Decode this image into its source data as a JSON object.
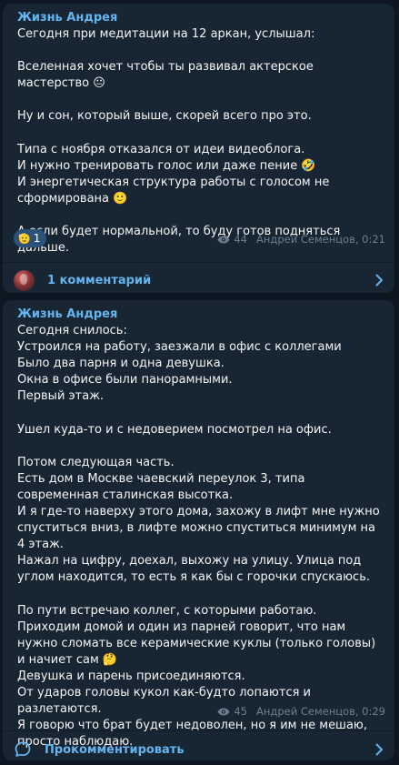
{
  "posts": [
    {
      "channel": "Жизнь Андрея",
      "text": "Сегодня при медитации на 12 аркан, услышал:\n\nВселенная хочет чтобы ты развивал актерское мастерство 😐\n\nНу и сон, который выше, скорей всего про это.\n\nТипа с ноября отказался от идеи видеоблога.\nИ нужно тренировать голос или даже пение 🤣\nИ энергетическая структура работы с голосом не сформирована 🙂\n\nА если будет нормальной, то буду готов подняться дальше.",
      "reaction_emoji": "🫡",
      "reaction_count": "1",
      "views": "44",
      "author_time": "Андрей Семенцов, 0:21",
      "comments_label": "1 комментарий",
      "icon": "eye-icon"
    },
    {
      "channel": "Жизнь Андрея",
      "text": "Сегодня снилось:\nУстроился на работу, заезжали в офис с коллегами\nБыло два парня и одна девушка.\nОкна в офисе были панорамными.\nПервый этаж.\n\nУшел куда-то и с недоверием посмотрел на офис.\n\nПотом следующая часть.\nЕсть дом в Москве чаевский переулок 3, типа современная сталинская высотка.\nИ я где-то наверху этого дома, захожу в лифт мне нужно спуститься вниз, в лифте можно спуститься минимум на 4 этаж.\nНажал на цифру, доехал, выхожу на улицу. Улица под углом находится, то есть я как бы с горочки спускаюсь.\n\nПо пути встречаю коллег, с которыми работаю.\nПриходим домой и один из парней говорит, что нам нужно сломать все керамические куклы (только головы) и начиет сам 🤔\nДевушка и парень присоединяются.\nОт ударов головы кукол как-будто лопаются и разлетаются.\nЯ говорю что брат будет недоволен, но я им не мешаю, просто наблюдаю.",
      "views": "45",
      "author_time": "Андрей Семенцов, 0:29",
      "comments_label": "Прокомментировать"
    }
  ],
  "colors": {
    "background": "#0e1621",
    "bubble": "#182533",
    "accent": "#64b5ef",
    "text": "#f5f5f5",
    "meta": "#6d7f8f"
  }
}
